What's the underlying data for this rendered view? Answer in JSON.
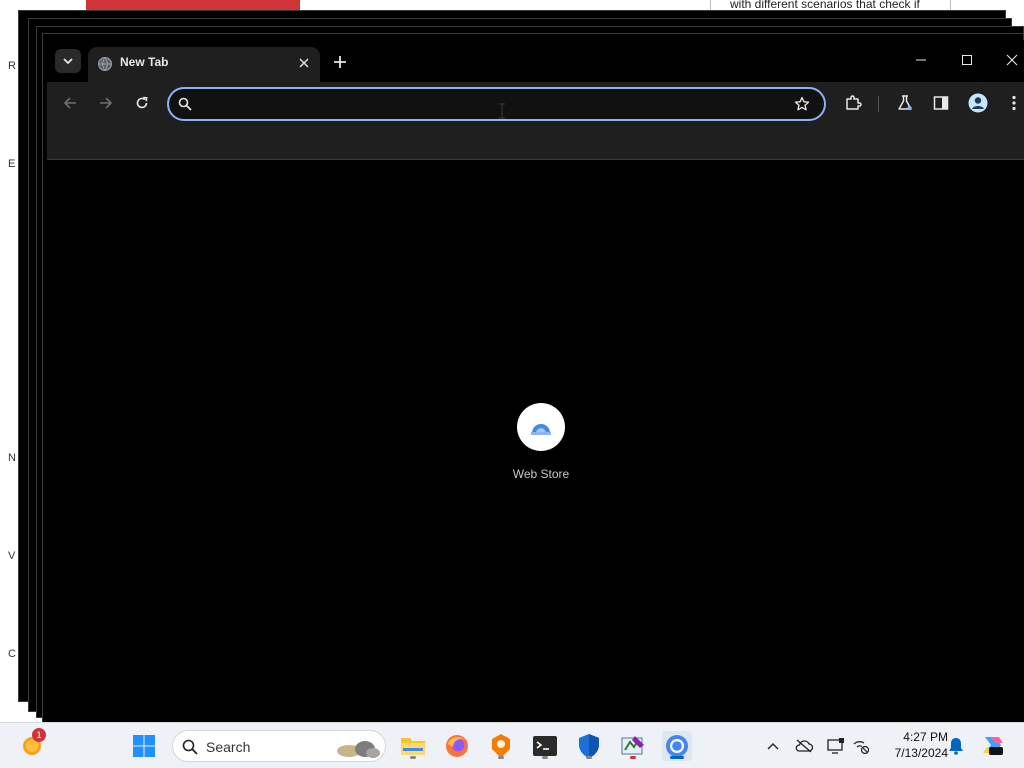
{
  "background": {
    "right_text": "with different scenarios that check if"
  },
  "tab": {
    "title": "New Tab",
    "favicon": "globe-icon"
  },
  "omnibox": {
    "value": "",
    "placeholder": ""
  },
  "shortcut": {
    "label": "Web Store",
    "icon": "web-store-icon"
  },
  "taskbar": {
    "search_label": "Search",
    "time": "4:27 PM",
    "date": "7/13/2024",
    "weather_badge": "1"
  },
  "colors": {
    "omnibox_focus": "#8ab4f8",
    "toolbar_bg": "#1f1f1f",
    "content_bg": "#000000",
    "taskbar_bg": "#eef1f6"
  }
}
